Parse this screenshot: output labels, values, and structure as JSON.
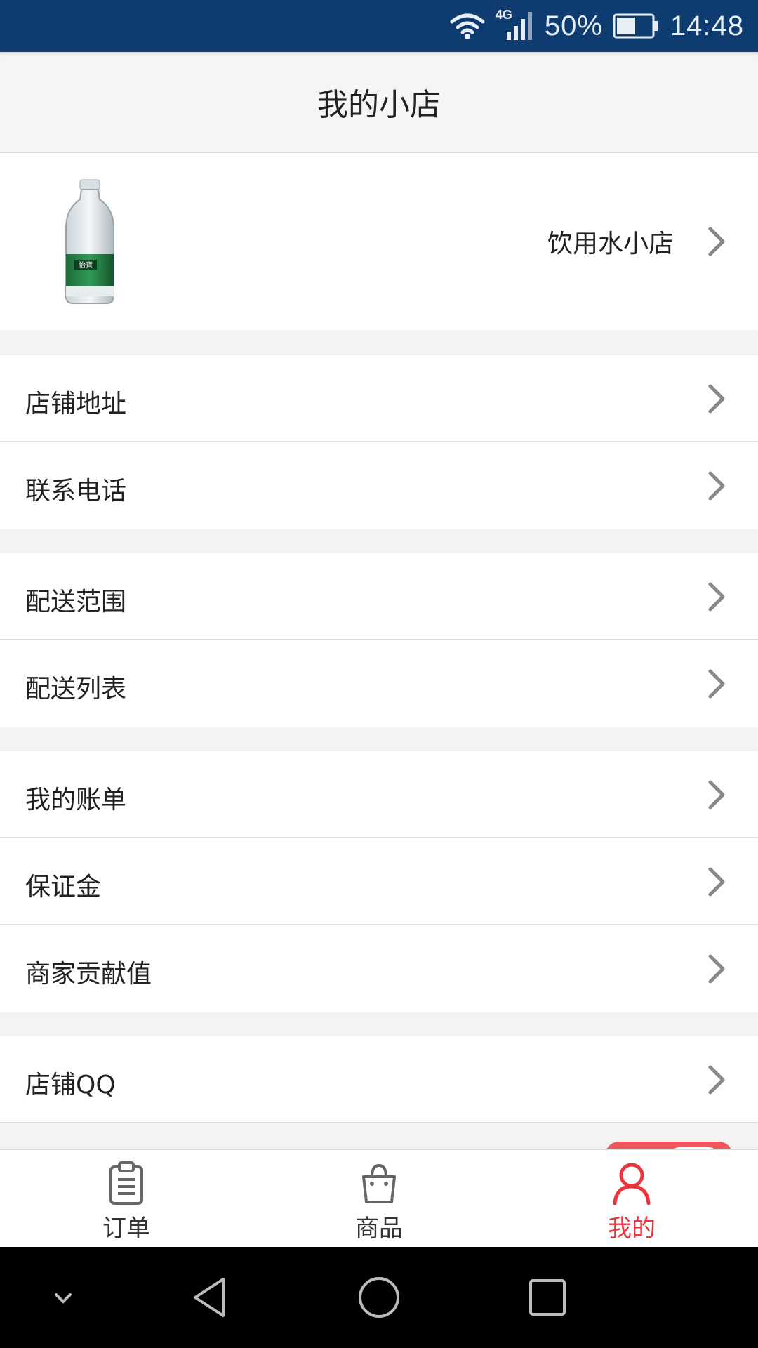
{
  "status_bar": {
    "network": "4G",
    "battery_percent": "50%",
    "time": "14:48"
  },
  "header": {
    "title": "我的小店"
  },
  "shop": {
    "name": "饮用水小店",
    "logo": "water-bottle-image"
  },
  "menu": {
    "group1": [
      {
        "label": "店铺地址"
      },
      {
        "label": "联系电话"
      }
    ],
    "group2": [
      {
        "label": "配送范围"
      },
      {
        "label": "配送列表"
      }
    ],
    "group3": [
      {
        "label": "我的账单"
      },
      {
        "label": "保证金"
      },
      {
        "label": "商家贡献值"
      }
    ],
    "group4": [
      {
        "label": "店铺QQ"
      }
    ]
  },
  "tabs": [
    {
      "label": "订单",
      "icon": "clipboard-icon",
      "active": false
    },
    {
      "label": "商品",
      "icon": "shopping-bag-icon",
      "active": false
    },
    {
      "label": "我的",
      "icon": "user-icon",
      "active": true
    }
  ],
  "colors": {
    "status_bar": "#0f3c70",
    "accent": "#e8353e"
  }
}
